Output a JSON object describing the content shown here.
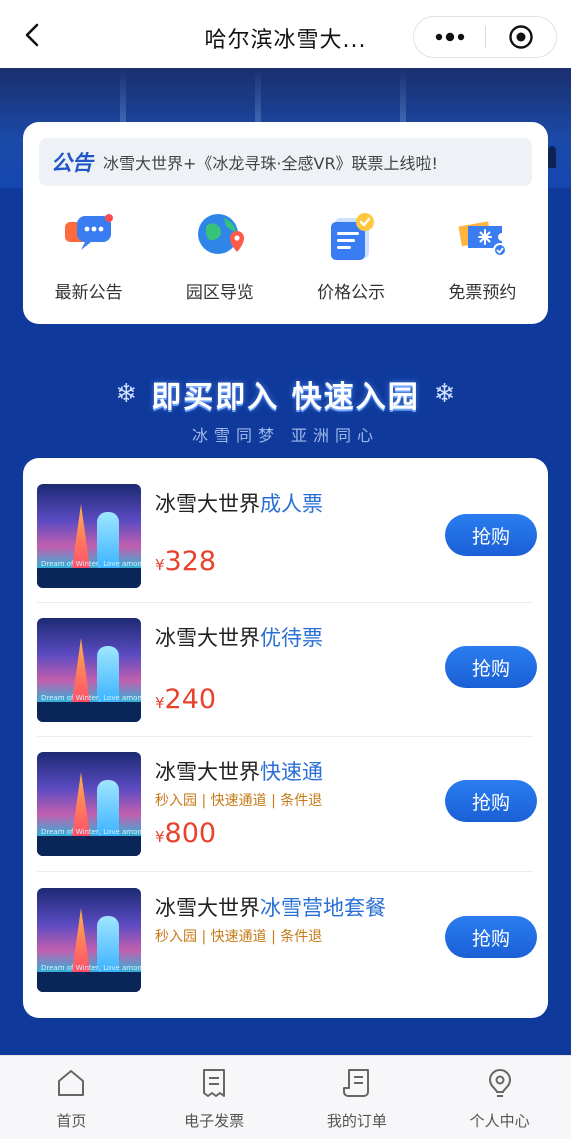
{
  "header": {
    "title": "哈尔滨冰雪大...",
    "back_icon": "chevron-left-icon",
    "more_icon": "more-dots-icon",
    "target_icon": "target-icon"
  },
  "notice": {
    "logo": "公告",
    "text": "冰雪大世界+《冰龙寻珠·全感VR》联票上线啦!"
  },
  "quick_links": [
    {
      "label": "最新公告",
      "icon": "announcement-chat-icon"
    },
    {
      "label": "园区导览",
      "icon": "globe-map-icon"
    },
    {
      "label": "价格公示",
      "icon": "price-notepad-icon"
    },
    {
      "label": "免票预约",
      "icon": "ticket-snowflake-icon"
    }
  ],
  "slogan": {
    "main": "即买即入 快速入园",
    "sub": "冰雪同梦 亚洲同心"
  },
  "products": [
    {
      "name_prefix": "冰雪大世界",
      "name_highlight": "成人票",
      "tags": "",
      "currency": "¥",
      "price": "328",
      "buy_label": "抢购",
      "thumb_caption": "Dream of Winter, Love among Asia"
    },
    {
      "name_prefix": "冰雪大世界",
      "name_highlight": "优待票",
      "tags": "",
      "currency": "¥",
      "price": "240",
      "buy_label": "抢购",
      "thumb_caption": "Dream of Winter, Love among Asia"
    },
    {
      "name_prefix": "冰雪大世界",
      "name_highlight": "快速通",
      "tags": "秒入园 | 快速通道 | 条件退",
      "currency": "¥",
      "price": "800",
      "buy_label": "抢购",
      "thumb_caption": "Dream of Winter, Love among Asia"
    },
    {
      "name_prefix": "冰雪大世界",
      "name_highlight": "冰雪营地套餐",
      "tags": "秒入园 | 快速通道 | 条件退",
      "currency": "",
      "price": "",
      "buy_label": "抢购",
      "thumb_caption": "Dream of Winter, Love among Asia"
    }
  ],
  "tabs": [
    {
      "label": "首页",
      "icon": "home-icon"
    },
    {
      "label": "电子发票",
      "icon": "invoice-icon"
    },
    {
      "label": "我的订单",
      "icon": "order-scroll-icon"
    },
    {
      "label": "个人中心",
      "icon": "profile-icon"
    }
  ],
  "colors": {
    "page_bg": "#0f3a9c",
    "accent": "#2a6fd6",
    "price": "#e8422c",
    "tag": "#c77a1a"
  }
}
